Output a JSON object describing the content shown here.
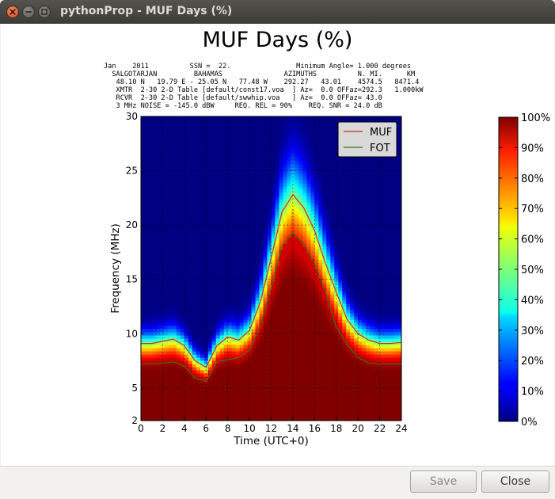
{
  "window": {
    "title": "pythonProp - MUF Days (%)",
    "close_icon": "window-close-icon",
    "min_icon": "window-minimize-icon",
    "max_icon": "window-maximize-icon"
  },
  "buttons": {
    "save": "Save",
    "close": "Close"
  },
  "chart_data": {
    "type": "heatmap",
    "title": "MUF Days (%)",
    "header_lines": [
      "Jan    2011          SSN =  22.                Minimum Angle= 1.000 degrees",
      "  SALGOTARJAN         BAHAMAS               AZIMUTHS          N. MI.      KM",
      "   48.10 N   19.79 E - 25.05 N   77.48 W    292.27   43.01    4574.5   8471.4",
      "   XMTR  2-30 2-D Table [default/const17.voa  ] Az=  0.0 OFFaz=292.3   1.000kW",
      "   RCVR  2-30 2-D Table [default/swwhip.voa   ] Az=  0.0 OFFaz= 43.0",
      "   3 MHz NOISE = -145.0 dBW     REQ. REL = 90%    REQ. SNR = 24.0 dB"
    ],
    "xlabel": "Time (UTC+0)",
    "ylabel": "Frequency (MHz)",
    "xlim": [
      0,
      24
    ],
    "ylim": [
      2,
      30
    ],
    "xticks": [
      0,
      2,
      4,
      6,
      8,
      10,
      12,
      14,
      16,
      18,
      20,
      22,
      24
    ],
    "yticks": [
      2,
      5,
      10,
      15,
      20,
      25,
      30
    ],
    "grid": true,
    "legend_position": "top-right",
    "colorbar": {
      "ticks": [
        "0%",
        "10%",
        "20%",
        "30%",
        "40%",
        "50%",
        "60%",
        "70%",
        "80%",
        "90%",
        "100%"
      ],
      "colormap": "jet"
    },
    "x": [
      0,
      1,
      2,
      3,
      4,
      5,
      6,
      7,
      8,
      9,
      10,
      11,
      12,
      13,
      14,
      15,
      16,
      17,
      18,
      19,
      20,
      21,
      22,
      23,
      24
    ],
    "series": [
      {
        "name": "MUF",
        "color": "#d62728",
        "values": [
          9.1,
          9.1,
          9.3,
          9.5,
          8.9,
          7.5,
          6.9,
          8.9,
          9.7,
          9.4,
          10.3,
          12.9,
          17.0,
          21.2,
          22.8,
          21.6,
          19.5,
          16.5,
          13.8,
          11.3,
          10.0,
          9.4,
          9.1,
          9.1,
          9.2
        ]
      },
      {
        "name": "FOT",
        "color": "#2c7a1e",
        "values": [
          7.2,
          7.2,
          7.3,
          7.4,
          7.0,
          5.9,
          5.6,
          7.4,
          7.6,
          7.8,
          8.5,
          10.7,
          14.2,
          18.1,
          19.3,
          18.3,
          16.5,
          13.9,
          10.6,
          9.0,
          7.8,
          7.3,
          7.2,
          7.2,
          7.2
        ]
      }
    ],
    "heatmap_model": {
      "description_free": "",
      "width_scale_mhz": [
        0.75,
        0.9
      ]
    }
  }
}
